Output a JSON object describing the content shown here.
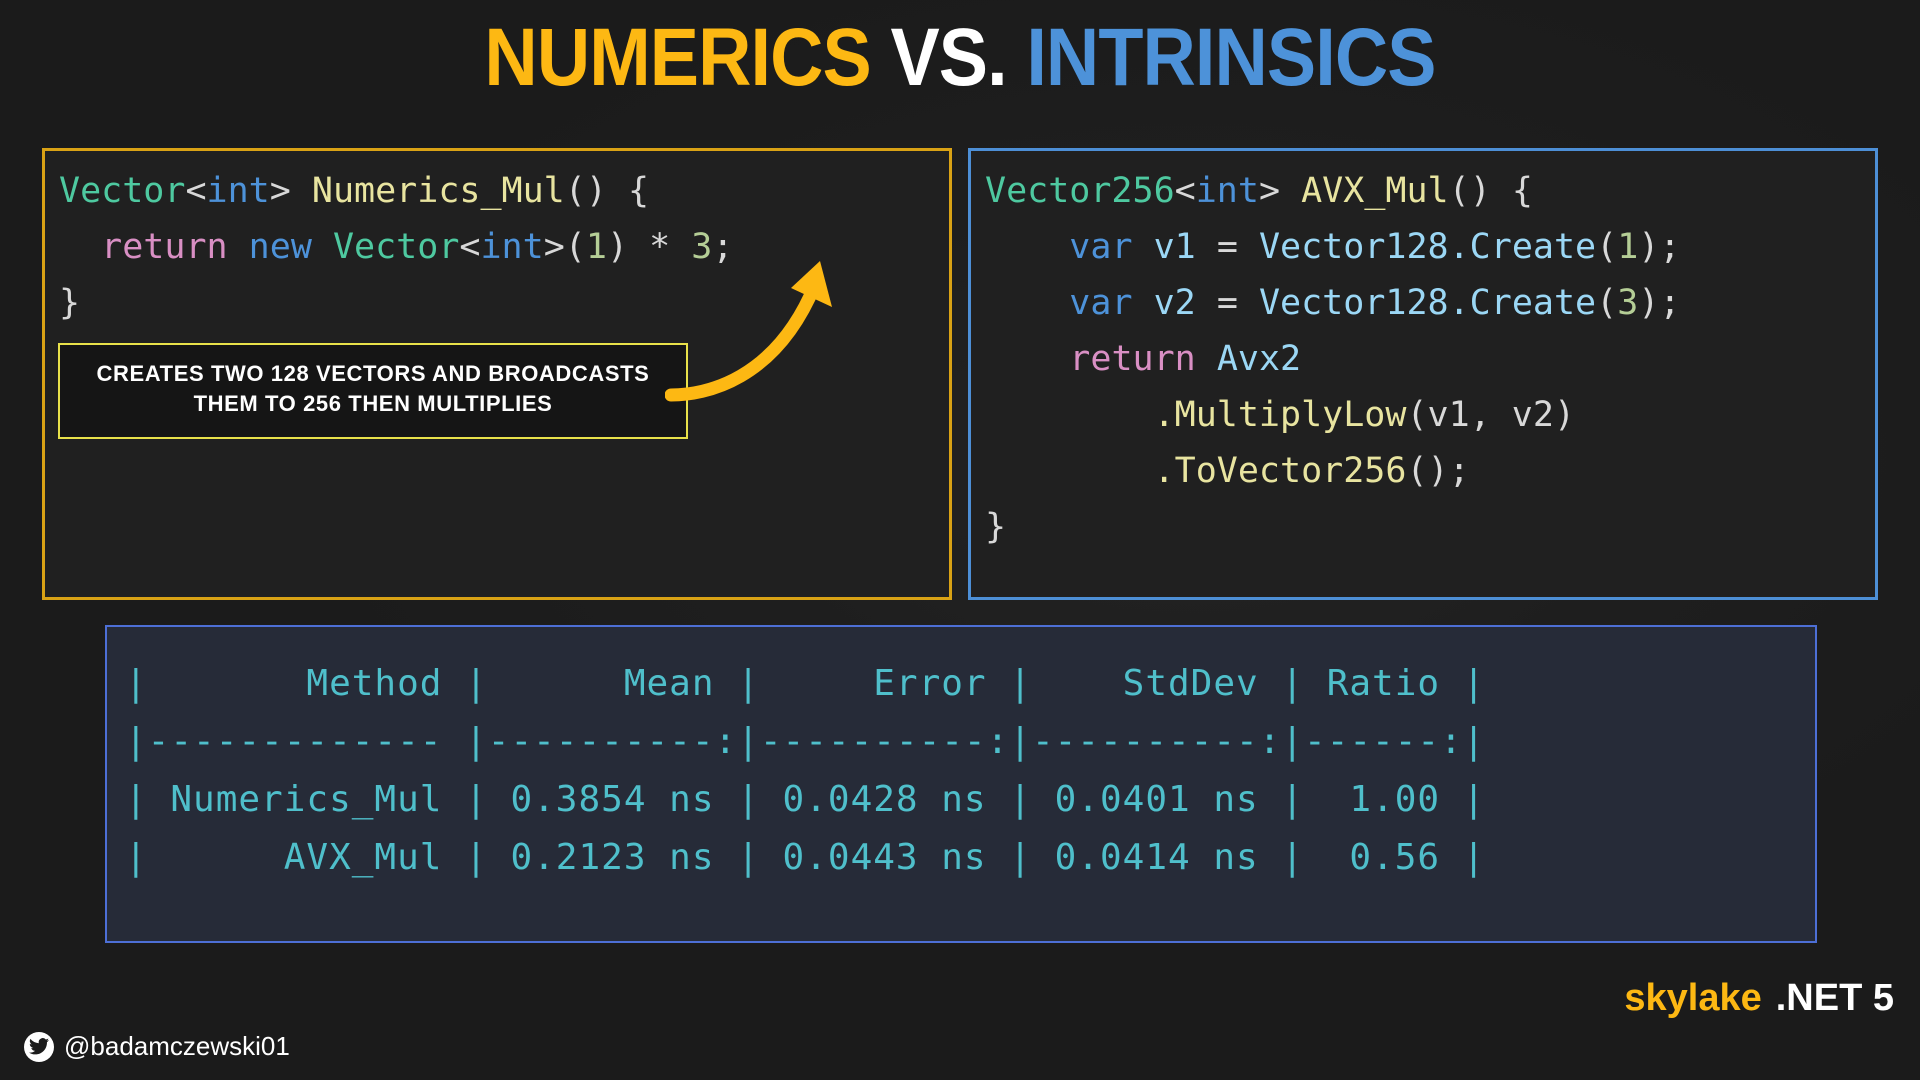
{
  "title": {
    "part_numerics": "NUMERICS",
    "part_vs": "VS.",
    "part_intrinsics": "INTRINSICS",
    "color_numerics": "#FDB813",
    "color_vs": "#FFFFFF",
    "color_intrinsics": "#4D92D9"
  },
  "left_code": {
    "border_color": "#D9A215",
    "line1": {
      "type": "Vector",
      "lt": "<",
      "generic": "int",
      "gt": ">",
      "space": " ",
      "fn": "Numerics_Mul",
      "tail": "() {"
    },
    "line2": {
      "indent": "  ",
      "ret": "return",
      "sp1": " ",
      "kw_new": "new",
      "sp2": " ",
      "type": "Vector",
      "lt": "<",
      "generic": "int",
      "gt": ">",
      "open": "(",
      "num1": "1",
      "close": ")",
      "op": " * ",
      "num2": "3",
      "semi": ";"
    },
    "line3": "}"
  },
  "callout": {
    "text": "CREATES TWO 128 VECTORS AND BROADCASTS THEM TO 256 THEN MULTIPLIES",
    "border_color": "#E8E14A"
  },
  "arrow": {
    "color": "#FDB813"
  },
  "right_code": {
    "border_color": "#4D8FD6",
    "line1": {
      "type": "Vector256",
      "lt": "<",
      "generic": "int",
      "gt": ">",
      "sp": " ",
      "fn": "AVX_Mul",
      "tail": "() {"
    },
    "line2": {
      "indent": "    ",
      "kw": "var",
      "sp": " ",
      "name": "v1",
      "eq": " = ",
      "call": "Vector128.Create",
      "open": "(",
      "num": "1",
      "close": ");"
    },
    "line3": {
      "indent": "    ",
      "kw": "var",
      "sp": " ",
      "name": "v2",
      "eq": " = ",
      "call": "Vector128.Create",
      "open": "(",
      "num": "3",
      "close": ");"
    },
    "line4": {
      "indent": "    ",
      "ret": "return",
      "sp": " ",
      "cls": "Avx2"
    },
    "line5": {
      "indent": "        ",
      "method": ".MultiplyLow",
      "args": "(v1, v2)"
    },
    "line6": {
      "indent": "        ",
      "method": ".ToVector256",
      "args": "();"
    },
    "line7": "}"
  },
  "benchmark": {
    "border_color": "#4D6FD6",
    "text_color": "#4FBFCB",
    "columns": [
      "Method",
      "Mean",
      "Error",
      "StdDev",
      "Ratio"
    ],
    "rows": [
      {
        "method": "Numerics_Mul",
        "mean": "0.3854 ns",
        "error": "0.0428 ns",
        "stddev": "0.0401 ns",
        "ratio": "1.00"
      },
      {
        "method": "AVX_Mul",
        "mean": "0.2123 ns",
        "error": "0.0443 ns",
        "stddev": "0.0414 ns",
        "ratio": "0.56"
      }
    ],
    "raw": "|       Method |      Mean |     Error |    StdDev | Ratio |\n|------------- |----------:|----------:|----------:|------:|\n| Numerics_Mul | 0.3854 ns | 0.0428 ns | 0.0401 ns |  1.00 |\n|      AVX_Mul | 0.2123 ns | 0.0443 ns | 0.0414 ns |  0.56 |"
  },
  "footer": {
    "twitter_handle": "@badamczewski01",
    "twitter_icon": "twitter-bird-icon",
    "skylake": "skylake",
    "dotnet": ".NET 5"
  }
}
